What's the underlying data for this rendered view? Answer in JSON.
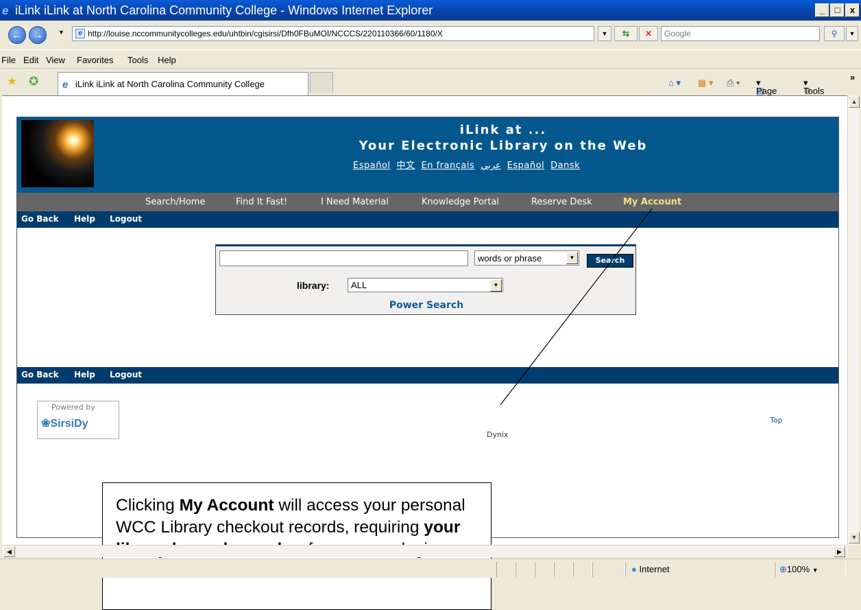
{
  "window": {
    "title": "iLink iLink at North Carolina Community College - Windows Internet Explorer",
    "controls": [
      "_",
      "□",
      "x"
    ]
  },
  "address_bar": {
    "url": "http://louise.nccommunitycolleges.edu/uhtbin/cgisirsi/Dfh0FBuMOI/NCCCS/220110366/60/1180/X",
    "search_placeholder": "Google"
  },
  "menu": [
    "File",
    "Edit",
    "View",
    "Favorites",
    "Tools",
    "Help"
  ],
  "tab": {
    "title": "iLink iLink at North Carolina Community College"
  },
  "command_bar": {
    "page": "Page",
    "tools": "Tools"
  },
  "banner": {
    "line1": "iLink at ...",
    "line2": "Your Electronic Library on the Web",
    "languages": [
      "Español",
      "中文",
      "En français",
      "عربي",
      "Español",
      "Dansk"
    ]
  },
  "main_nav": [
    "Search/Home",
    "Find It Fast!",
    "I Need Material",
    "Knowledge Portal",
    "Reserve Desk",
    "My Account"
  ],
  "sub_nav": [
    "Go Back",
    "Help",
    "Logout"
  ],
  "search": {
    "query_value": "",
    "type_selected": "words or phrase",
    "button": "Search",
    "library_label": "library:",
    "library_selected": "ALL",
    "power_search": "Power Search"
  },
  "footer": {
    "powered_by": "Powered by",
    "brand": "SirsiDy",
    "copyright_fragment": "Dynix",
    "top_link": "Top"
  },
  "callout": {
    "t1": "Clicking ",
    "b1": "My Account",
    "t2": " will access your personal WCC Library checkout records, requiring ",
    "b2": "your library barcode number",
    "t3": " for a secure login."
  },
  "status_bar": {
    "zone": "Internet",
    "zoom": "100%"
  }
}
